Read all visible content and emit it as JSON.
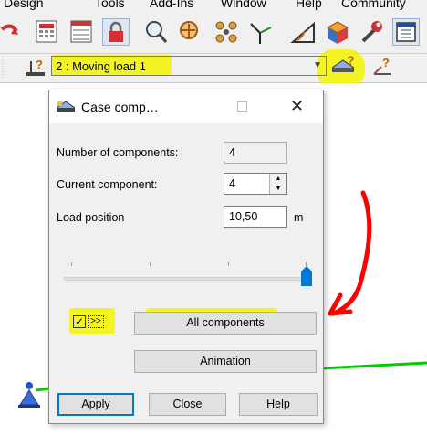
{
  "menu": [
    "Design",
    "Tools",
    "Add-Ins",
    "Window",
    "Help",
    "Community"
  ],
  "toolbar": {
    "load_case_combo_value": "2 : Moving load 1"
  },
  "dialog": {
    "title": "Case comp…",
    "number_of_components_label": "Number of components:",
    "number_of_components_value": "4",
    "current_component_label": "Current component:",
    "current_component_value": "4",
    "load_position_label": "Load position",
    "load_position_value": "10,50",
    "load_position_unit": "m",
    "all_components_checked": true,
    "toggle_label": ">>",
    "all_components_label": "All components",
    "animation_label": "Animation",
    "apply_label": "Apply",
    "close_label": "Close",
    "help_label": "Help",
    "slider_position": 1.0
  },
  "colors": {
    "highlight": "#f4f400",
    "annotation_arrow": "#ff0000",
    "member_line": "#00cc00",
    "accent": "#0078d7"
  }
}
